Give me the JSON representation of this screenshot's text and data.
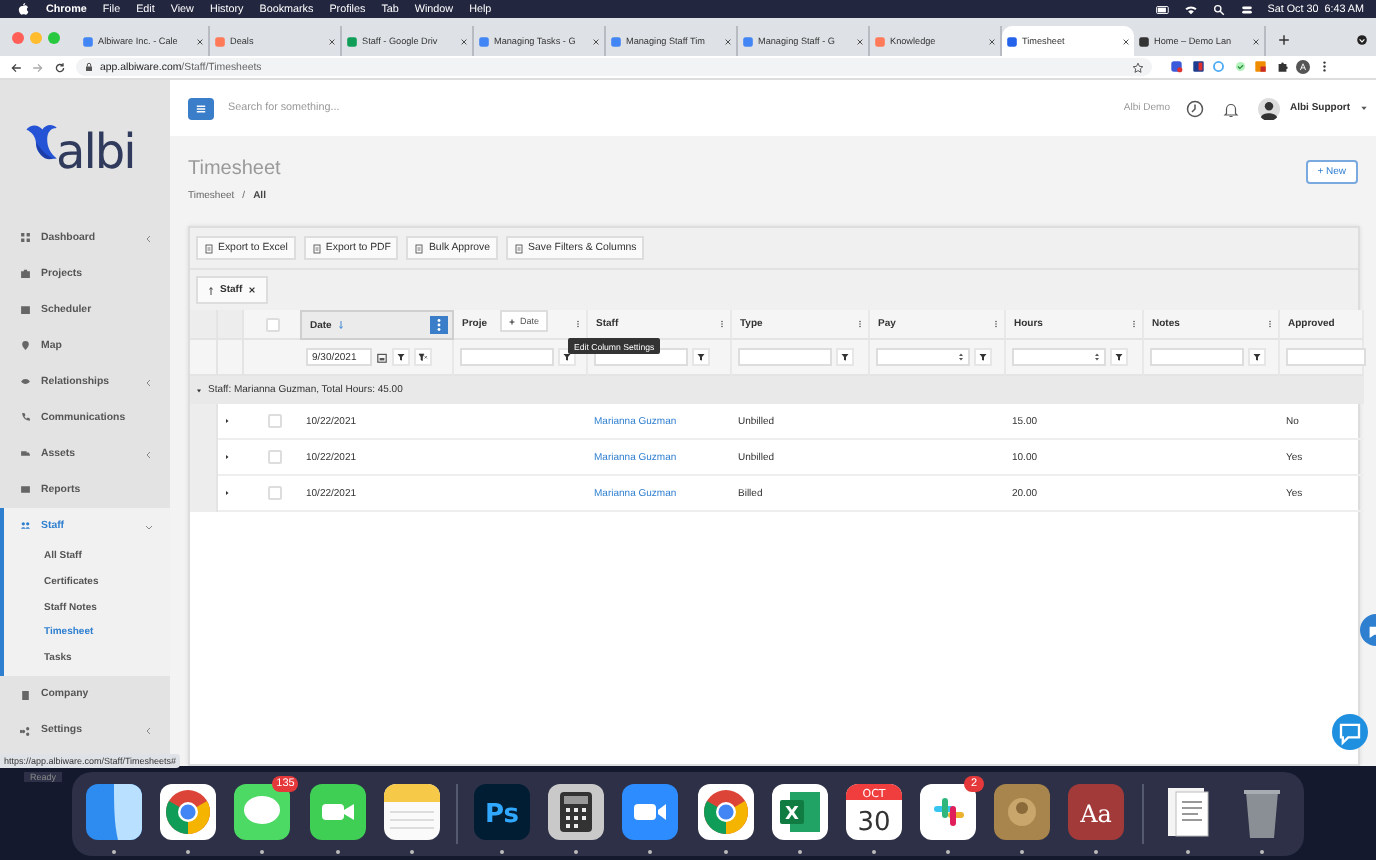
{
  "menu_bar": {
    "app": "Chrome",
    "items": [
      "File",
      "Edit",
      "View",
      "History",
      "Bookmarks",
      "Profiles",
      "Tab",
      "Window",
      "Help"
    ],
    "clock": "Sat Oct 30  6:43 AM"
  },
  "browser_tabs": [
    {
      "title": "Albiware Inc. - Cale",
      "selected": false
    },
    {
      "title": "Deals",
      "selected": false
    },
    {
      "title": "Staff - Google Driv",
      "selected": false
    },
    {
      "title": "Managing Tasks - G",
      "selected": false
    },
    {
      "title": "Managing Staff Tim",
      "selected": false
    },
    {
      "title": "Managing Staff - G",
      "selected": false
    },
    {
      "title": "Knowledge",
      "selected": false
    },
    {
      "title": "Timesheet",
      "selected": true
    },
    {
      "title": "Home – Demo Lan",
      "selected": false
    }
  ],
  "address_bar": {
    "host": "app.albiware.com",
    "path": "/Staff/Timesheets",
    "profile_initial": "A"
  },
  "sidebar": {
    "logo": "albi",
    "items": [
      {
        "label": "Dashboard",
        "expandable": true,
        "expanded": false,
        "selected": false
      },
      {
        "label": "Projects",
        "expandable": false,
        "expanded": false,
        "selected": false
      },
      {
        "label": "Scheduler",
        "expandable": false,
        "expanded": false,
        "selected": false
      },
      {
        "label": "Map",
        "expandable": false,
        "expanded": false,
        "selected": false
      },
      {
        "label": "Relationships",
        "expandable": true,
        "expanded": false,
        "selected": false
      },
      {
        "label": "Communications",
        "expandable": false,
        "expanded": false,
        "selected": false
      },
      {
        "label": "Assets",
        "expandable": true,
        "expanded": false,
        "selected": false
      },
      {
        "label": "Reports",
        "expandable": false,
        "expanded": false,
        "selected": false
      },
      {
        "label": "Staff",
        "expandable": true,
        "expanded": true,
        "selected": true,
        "children": [
          {
            "label": "All Staff",
            "selected": false
          },
          {
            "label": "Certificates",
            "selected": false
          },
          {
            "label": "Staff Notes",
            "selected": false
          },
          {
            "label": "Timesheet",
            "selected": true
          },
          {
            "label": "Tasks",
            "selected": false
          }
        ]
      },
      {
        "label": "Company",
        "expandable": false,
        "expanded": false,
        "selected": false
      },
      {
        "label": "Settings",
        "expandable": true,
        "expanded": false,
        "selected": false
      }
    ]
  },
  "header": {
    "search_placeholder": "Search for something...",
    "organization": "Albi Demo",
    "user": "Albi Support"
  },
  "page": {
    "title": "Timesheet",
    "breadcrumb": [
      "Timesheet",
      "All"
    ],
    "breadcrumb_separator": "/",
    "new_button": "+ New"
  },
  "toolbar": [
    "Export to Excel",
    "Export to PDF",
    "Bulk Approve",
    "Save Filters & Columns"
  ],
  "group_chip": {
    "label": "Staff"
  },
  "grid": {
    "header_checked": false,
    "columns": [
      {
        "label": "Date",
        "sorted": true,
        "menu_open": true,
        "filter": {
          "kind": "date",
          "value": "9/30/2021"
        }
      },
      {
        "label": "Proje",
        "sorted": false,
        "menu_open": false,
        "filter": {
          "kind": "text"
        }
      },
      {
        "label": "Staff",
        "sorted": false,
        "menu_open": false,
        "filter": {
          "kind": "text"
        }
      },
      {
        "label": "Type",
        "sorted": false,
        "menu_open": false,
        "filter": {
          "kind": "text"
        }
      },
      {
        "label": "Pay",
        "sorted": false,
        "menu_open": false,
        "filter": {
          "kind": "number"
        }
      },
      {
        "label": "Hours",
        "sorted": false,
        "menu_open": false,
        "filter": {
          "kind": "number"
        }
      },
      {
        "label": "Notes",
        "sorted": false,
        "menu_open": false,
        "filter": {
          "kind": "text"
        }
      },
      {
        "label": "Approved",
        "sorted": false,
        "menu_open": false,
        "filter": {
          "kind": "plain"
        }
      }
    ],
    "drag_label": "Date",
    "tooltip": "Edit Column Settings",
    "group_row": "Staff: Marianna Guzman, Total Hours: 45.00",
    "rows": [
      {
        "checked": false,
        "date": "10/22/2021",
        "staff": "Marianna Guzman",
        "type": "Unbilled",
        "hours": "15.00",
        "approved": "No"
      },
      {
        "checked": false,
        "date": "10/22/2021",
        "staff": "Marianna Guzman",
        "type": "Unbilled",
        "hours": "10.00",
        "approved": "Yes"
      },
      {
        "checked": false,
        "date": "10/22/2021",
        "staff": "Marianna Guzman",
        "type": "Billed",
        "hours": "20.00",
        "approved": "Yes"
      }
    ]
  },
  "status_bar": {
    "link_preview": "https://app.albiware.com/Staff/Timesheets#",
    "status": "Ready"
  },
  "dock": [
    {
      "kind": "finder"
    },
    {
      "kind": "chrome"
    },
    {
      "kind": "messages",
      "badge": "135"
    },
    {
      "kind": "facetime"
    },
    {
      "kind": "notes"
    },
    {
      "kind": "separator"
    },
    {
      "kind": "photoshop",
      "label": "Ps"
    },
    {
      "kind": "calculator"
    },
    {
      "kind": "zoom"
    },
    {
      "kind": "chrome"
    },
    {
      "kind": "excel",
      "label": "X"
    },
    {
      "kind": "calendar",
      "month": "OCT",
      "day": "30"
    },
    {
      "kind": "slack",
      "badge": "2"
    },
    {
      "kind": "contacts"
    },
    {
      "kind": "dictionary",
      "label": "Aa"
    },
    {
      "kind": "separator"
    },
    {
      "kind": "document"
    },
    {
      "kind": "trash"
    }
  ]
}
